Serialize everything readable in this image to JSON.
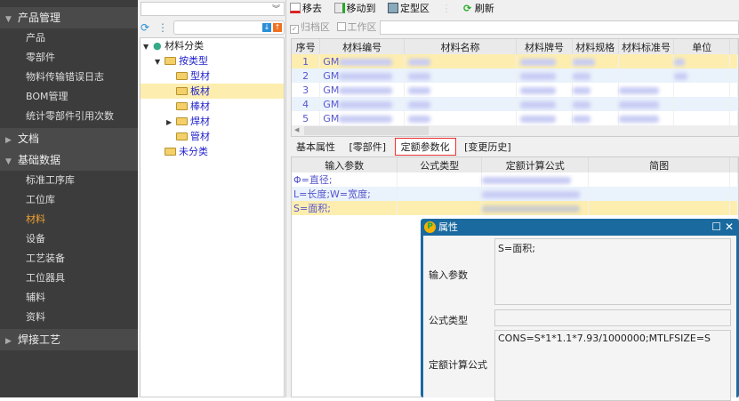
{
  "sidebar": {
    "groups": [
      {
        "label": "产品管理",
        "expanded": true,
        "items": [
          "产品",
          "零部件",
          "物料传输错误日志",
          "BOM管理",
          "统计零部件引用次数"
        ]
      },
      {
        "label": "文档",
        "expanded": false,
        "items": []
      },
      {
        "label": "基础数据",
        "expanded": true,
        "items": [
          "标准工序库",
          "工位库",
          "材料",
          "设备",
          "工艺装备",
          "工位器具",
          "辅料",
          "资料"
        ]
      },
      {
        "label": "焊接工艺",
        "expanded": false,
        "items": []
      }
    ],
    "active": "材料"
  },
  "tree": {
    "root": "材料分类",
    "nodes": [
      "按类型",
      "型材",
      "板材",
      "棒材",
      "焊材",
      "管材",
      "未分类"
    ],
    "selected": "板材"
  },
  "toolbar": {
    "remove": "移去",
    "move_to": "移动到",
    "fixed_area": "定型区",
    "refresh": "刷新"
  },
  "filter": {
    "archive": "归档区",
    "archive_checked": true,
    "work": "工作区",
    "work_checked": false
  },
  "grid": {
    "columns": [
      "序号",
      "材料编号",
      "材料名称",
      "材料牌号",
      "材料规格",
      "材料标准号",
      "单位"
    ],
    "rows": [
      {
        "no": "1",
        "code": "GM"
      },
      {
        "no": "2",
        "code": "GM"
      },
      {
        "no": "3",
        "code": "GM"
      },
      {
        "no": "4",
        "code": "GM"
      },
      {
        "no": "5",
        "code": "GM"
      }
    ]
  },
  "tabs": [
    "基本属性",
    "[零部件]",
    "定额参数化",
    "[变更历史]"
  ],
  "active_tab": "定额参数化",
  "param_grid": {
    "columns": [
      "输入参数",
      "公式类型",
      "定额计算公式",
      "简图"
    ],
    "rows": [
      "Φ=直径;",
      "L=长度;W=宽度;",
      "S=面积;"
    ]
  },
  "dialog": {
    "title": "属性",
    "input_label": "输入参数",
    "input_value": "S=面积;",
    "type_label": "公式类型",
    "type_value": "",
    "formula_label": "定额计算公式",
    "formula_value": "CONS=S*1*1.1*7.93/1000000;MTLFSIZE=S"
  }
}
